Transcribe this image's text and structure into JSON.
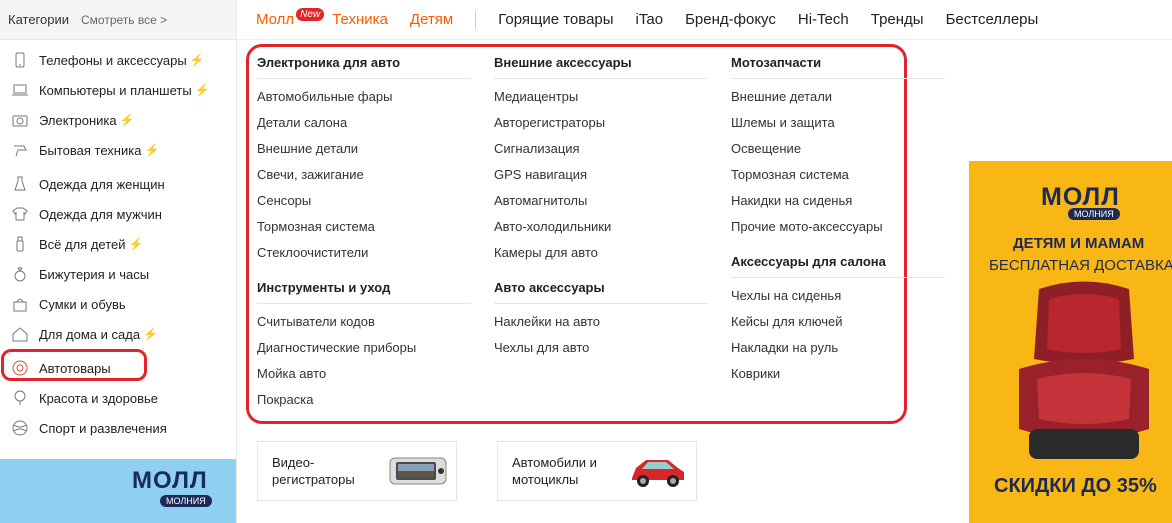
{
  "sidebar": {
    "title": "Категории",
    "see_all": "Смотреть все >",
    "items": [
      {
        "label": "Телефоны и аксессуары",
        "icon": "phone-icon",
        "bolt": true
      },
      {
        "label": "Компьютеры и планшеты",
        "icon": "laptop-icon",
        "bolt": true
      },
      {
        "label": "Электроника",
        "icon": "camera-icon",
        "bolt": true
      },
      {
        "label": "Бытовая техника",
        "icon": "appliance-icon",
        "bolt": true
      },
      {
        "label": "Одежда для женщин",
        "icon": "dress-icon",
        "bolt": false
      },
      {
        "label": "Одежда для мужчин",
        "icon": "shirt-icon",
        "bolt": false
      },
      {
        "label": "Всё для детей",
        "icon": "bottle-icon",
        "bolt": true
      },
      {
        "label": "Бижутерия и часы",
        "icon": "ring-icon",
        "bolt": false
      },
      {
        "label": "Сумки и обувь",
        "icon": "bag-icon",
        "bolt": false
      },
      {
        "label": "Для дома и сада",
        "icon": "house-icon",
        "bolt": true
      },
      {
        "label": "Автотовары",
        "icon": "wheel-icon",
        "bolt": false
      },
      {
        "label": "Красота и здоровье",
        "icon": "mirror-icon",
        "bolt": false
      },
      {
        "label": "Спорт и развлечения",
        "icon": "ball-icon",
        "bolt": false
      }
    ],
    "bolt_char": "⚡",
    "banner": {
      "logo": "МОЛЛ",
      "sub": "МОЛНИЯ"
    }
  },
  "topnav": {
    "mall": "Молл",
    "new_badge": "New",
    "tech": "Техника",
    "kids": "Детям",
    "links": [
      "Горящие товары",
      "iTao",
      "Бренд-фокус",
      "Hi-Tech",
      "Тренды",
      "Бестселлеры"
    ]
  },
  "mega": {
    "col1": [
      {
        "title": "Электроника для авто",
        "links": [
          "Автомобильные фары",
          "Детали салона",
          "Внешние детали",
          "Свечи, зажигание",
          "Сенсоры",
          "Тормозная система",
          "Стеклоочистители"
        ]
      },
      {
        "title": "Инструменты и уход",
        "links": [
          "Считыватели кодов",
          "Диагностические приборы",
          "Мойка авто",
          "Покраска"
        ]
      }
    ],
    "col2": [
      {
        "title": "Внешние аксессуары",
        "links": [
          "Медиацентры",
          "Авторегистраторы",
          "Сигнализация",
          "GPS навигация",
          "Автомагнитолы",
          "Авто-холодильники",
          "Камеры для авто"
        ]
      },
      {
        "title": "Авто аксессуары",
        "links": [
          "Наклейки на авто",
          "Чехлы для авто"
        ]
      }
    ],
    "col3": [
      {
        "title": "Мотозапчасти",
        "links": [
          "Внешние детали",
          "Шлемы и защита",
          "Освещение",
          "Тормозная система",
          "Накидки на сиденья",
          "Прочие мото-аксессуары"
        ]
      },
      {
        "title": "Аксессуары для салона",
        "links": [
          "Чехлы на сиденья",
          "Кейсы для ключей",
          "Накладки на руль",
          "Коврики"
        ]
      }
    ]
  },
  "cards": [
    {
      "label": "Видео-\nрегистраторы"
    },
    {
      "label": "Автомобили и\nмотоциклы"
    }
  ],
  "right_banner": {
    "logo": "МОЛЛ",
    "sub": "МОЛНИЯ",
    "line1": "ДЕТЯМ И МАМАМ",
    "line2": "БЕСПЛАТНАЯ ДОСТАВКА",
    "sale": "СКИДКИ ДО 35%"
  },
  "colors": {
    "accent": "#ff5a00",
    "highlight_red": "#e2232a",
    "banner_yellow": "#f8b715"
  }
}
